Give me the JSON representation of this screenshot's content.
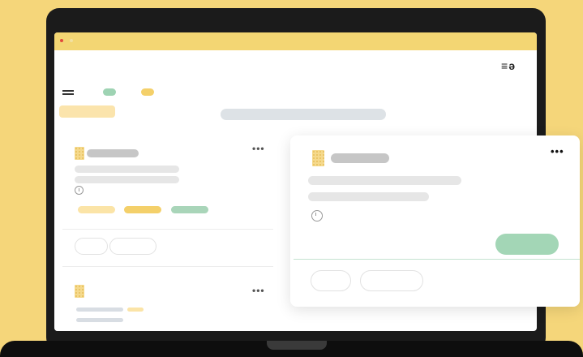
{
  "app": {
    "logo_text": "≡ə"
  },
  "colors": {
    "background": "#f5d67a",
    "accent_green": "#9ed3b3",
    "accent_yellow": "#f4d06a",
    "titlebar": "#f3d673"
  },
  "icons": {
    "menu": "hamburger-icon",
    "more": "more-dots-icon",
    "clock": "clock-icon",
    "building": "building-icon"
  },
  "list": {
    "more_label": "•••"
  },
  "card": {
    "more_label": "•••"
  }
}
